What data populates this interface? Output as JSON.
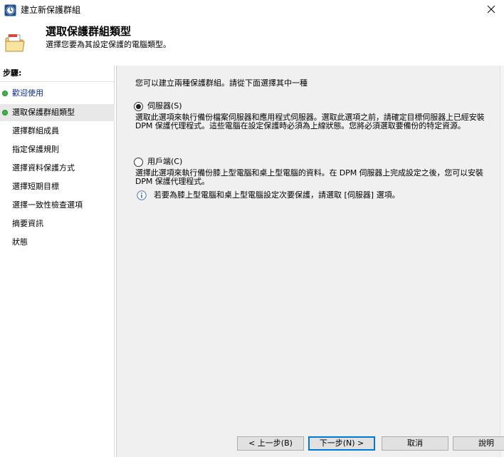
{
  "window": {
    "title": "建立新保護群組",
    "app_icon": "dpm-clock-icon",
    "close_icon": "close-icon"
  },
  "header": {
    "title": "選取保護群組類型",
    "subtitle": "選擇您要為其設定保護的電腦類型。",
    "icon": "folder-icon"
  },
  "steps": {
    "label": "步驟:",
    "items": [
      {
        "label": "歡迎使用",
        "status": "done",
        "link": true
      },
      {
        "label": "選取保護群組類型",
        "status": "current",
        "link": false
      },
      {
        "label": "選擇群組成員",
        "status": "pending",
        "link": false
      },
      {
        "label": "指定保護規則",
        "status": "pending",
        "link": false
      },
      {
        "label": "選擇資料保護方式",
        "status": "pending",
        "link": false
      },
      {
        "label": "選擇短期目標",
        "status": "pending",
        "link": false
      },
      {
        "label": "選擇一致性檢查選項",
        "status": "pending",
        "link": false
      },
      {
        "label": "摘要資訊",
        "status": "pending",
        "link": false
      },
      {
        "label": "狀態",
        "status": "pending",
        "link": false
      }
    ]
  },
  "main": {
    "intro": "您可以建立兩種保護群組。請從下面選擇其中一種",
    "options": [
      {
        "label": "伺服器(S)",
        "selected": true,
        "description": "選取此選項來執行備份檔案伺服器和應用程式伺服器。選取此選項之前，請確定目標伺服器上已經安裝 DPM 保護代理程式。這些電腦在設定保護時必須為上線狀態。您將必須選取要備份的特定資源。"
      },
      {
        "label": "用戶端(C)",
        "selected": false,
        "description": "選擇此選項來執行備份膝上型電腦和桌上型電腦的資料。在 DPM 伺服器上完成設定之後，您可以安裝 DPM 保護代理程式。"
      }
    ],
    "info_text": "若要為膝上型電腦和桌上型電腦設定次要保護，請選取 [伺服器] 選項。"
  },
  "buttons": {
    "back": "< 上一步(B)",
    "next": "下一步(N) >",
    "cancel": "取消",
    "help": "說明"
  },
  "colors": {
    "step_done_dot": "#3cb545",
    "link_text": "#0b2d98",
    "content_bg": "#f0f0f0",
    "default_button_border": "#0078d7"
  }
}
